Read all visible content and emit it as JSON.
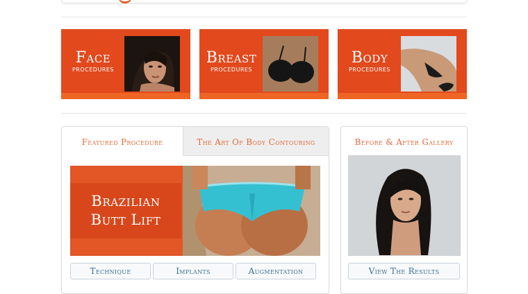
{
  "tiles": [
    {
      "title": "Face",
      "subtitle": "Procedures"
    },
    {
      "title": "Breast",
      "subtitle": "Procedures"
    },
    {
      "title": "Body",
      "subtitle": "Procedures"
    }
  ],
  "featured": {
    "tabs": [
      {
        "label": "Featured Procedure"
      },
      {
        "label": "The Art Of Body Contouring"
      }
    ],
    "hero_title_line1": "Brazilian",
    "hero_title_line2": "Butt Lift",
    "buttons": [
      {
        "label": "Technique"
      },
      {
        "label": "Implants"
      },
      {
        "label": "Augmentation"
      }
    ]
  },
  "gallery": {
    "title": "Before & After Gallery",
    "button_label": "View The Results"
  },
  "colors": {
    "accent": "#e2491d",
    "accent_light": "#ee6526",
    "link": "#3b6f98"
  }
}
